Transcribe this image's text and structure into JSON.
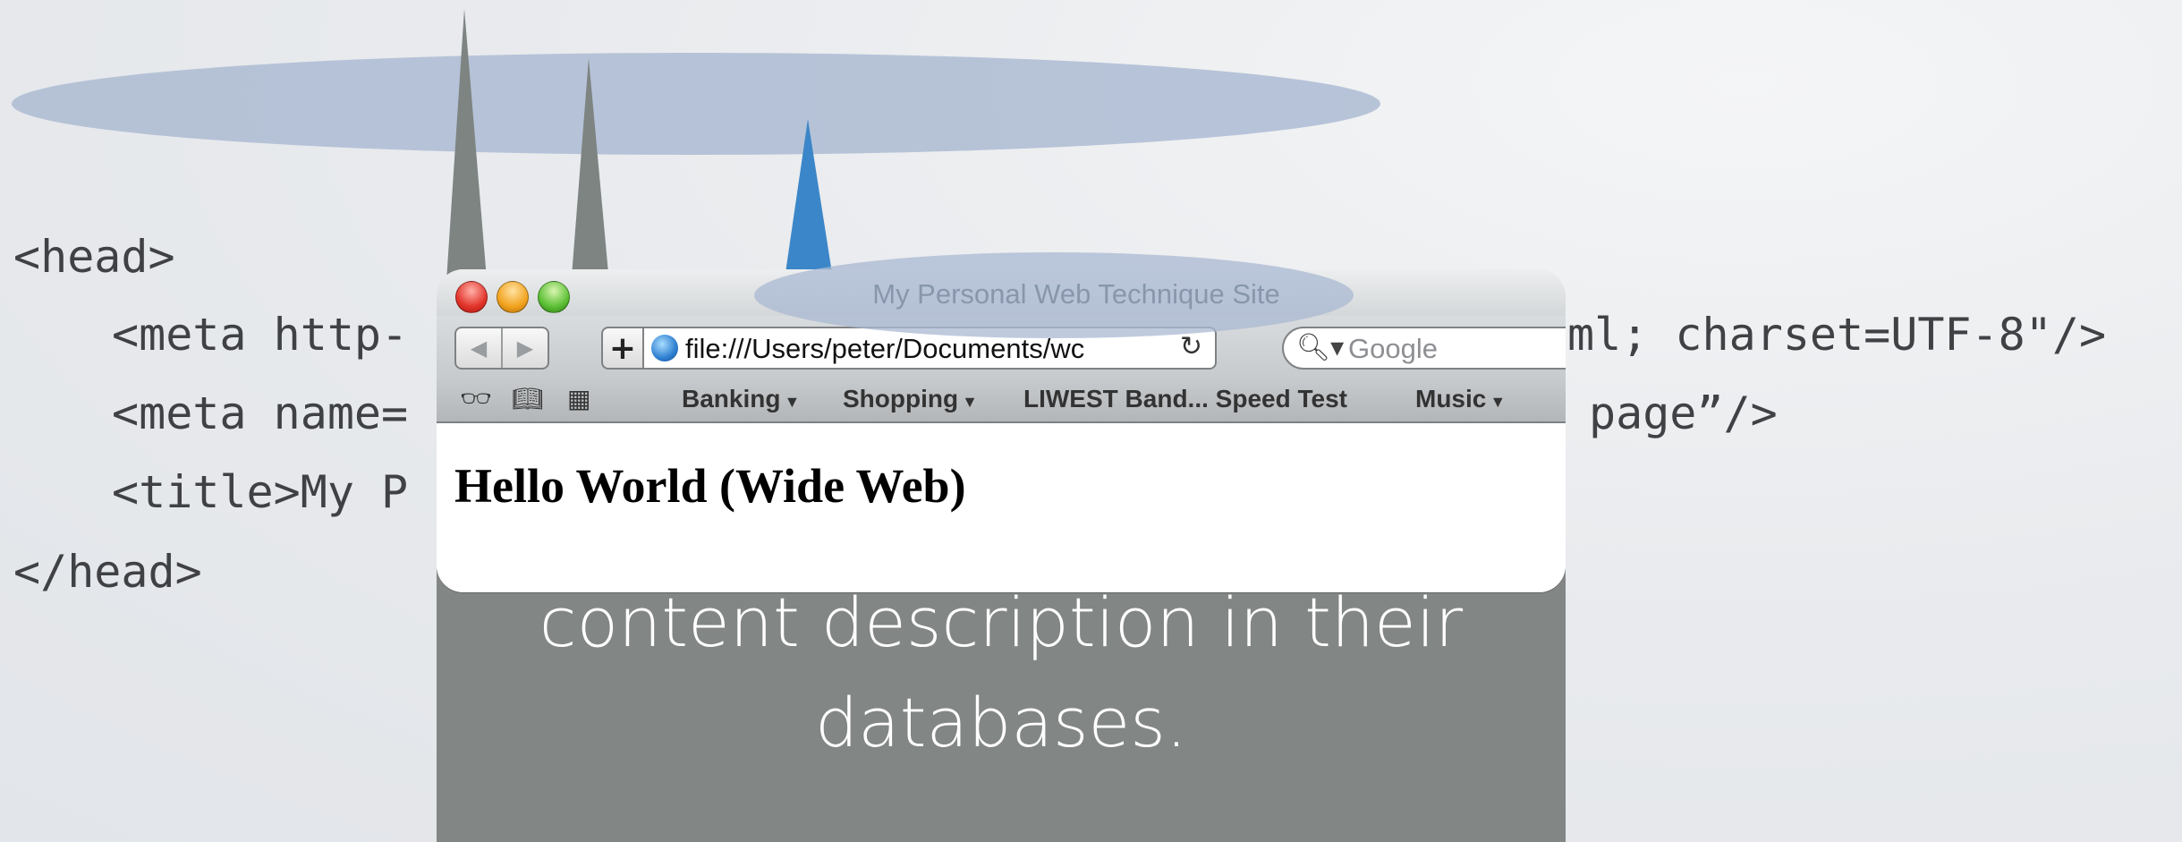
{
  "code_lines": [
    "<head>",
    "<meta http-",
    "ml; charset=UTF-8\"/>",
    "<meta name=",
    "page”/>",
    "<title>My P",
    "</head>"
  ],
  "callout_text": "content description in their\ndatabases.",
  "browser": {
    "window_title": "My Personal Web Technique Site",
    "back_icon": "back-arrow-icon",
    "forward_icon": "forward-arrow-icon",
    "add_bookmark_label": "+",
    "address": "file:///Users/peter/Documents/wc",
    "search_placeholder": "Google",
    "bookmarks": {
      "items": [
        {
          "label": "Banking",
          "has_menu": true
        },
        {
          "label": "Shopping",
          "has_menu": true
        },
        {
          "label": "LIWEST Band... Speed Test",
          "has_menu": false
        },
        {
          "label": "Music",
          "has_menu": true
        }
      ]
    },
    "page_heading": "Hello World (Wide Web)"
  },
  "colors": {
    "highlight_ellipse": "#a9b8d1",
    "pointer_gray": "#7d8482",
    "pointer_blue": "#3b86c8",
    "callout_bg": "#828684"
  }
}
